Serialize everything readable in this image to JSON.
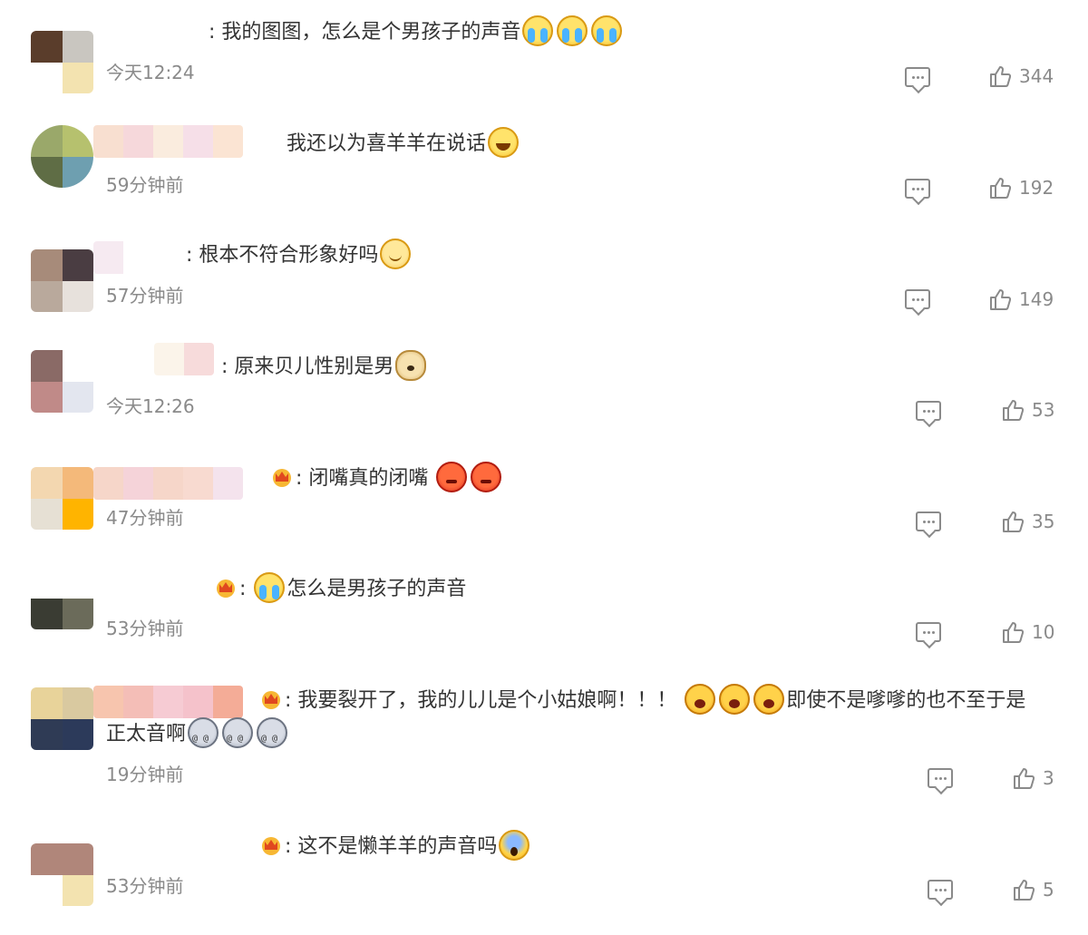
{
  "colors": {
    "text": "#333333",
    "meta": "#8a8a8a",
    "accent": "#f5b81c"
  },
  "comments": [
    {
      "text": "我的图图，怎么是个男孩子的声音",
      "emojis": [
        "cry",
        "cry",
        "cry"
      ],
      "time": "今天12:24",
      "likes": "344"
    },
    {
      "text": "我还以为喜羊羊在说话",
      "emojis": [
        "laugh"
      ],
      "time": "59分钟前",
      "likes": "192"
    },
    {
      "text": "根本不符合形象好吗",
      "emojis": [
        "smile"
      ],
      "time": "57分钟前",
      "likes": "149"
    },
    {
      "text": "原来贝儿性别是男",
      "emojis": [
        "doge"
      ],
      "time": "今天12:26",
      "likes": "53"
    },
    {
      "text": "闭嘴真的闭嘴",
      "emojis": [
        "angry",
        "angry"
      ],
      "time": "47分钟前",
      "likes": "35"
    },
    {
      "text": "怎么是男孩子的声音",
      "emojis": [
        "cry"
      ],
      "time": "53分钟前",
      "likes": "10"
    },
    {
      "text": "我要裂开了，我的儿儿是个小姑娘啊！！！",
      "text_b": "即使不是嗲嗲的也不至于是",
      "text_c": "正太音啊",
      "emojis": [
        "shout",
        "shout",
        "shout"
      ],
      "emojis_c": [
        "dizzy",
        "dizzy",
        "dizzy"
      ],
      "time": "19分钟前",
      "likes": "3"
    },
    {
      "text": "这不是懒羊羊的声音吗",
      "emojis": [
        "scared"
      ],
      "time": "53分钟前",
      "likes": "5"
    }
  ]
}
